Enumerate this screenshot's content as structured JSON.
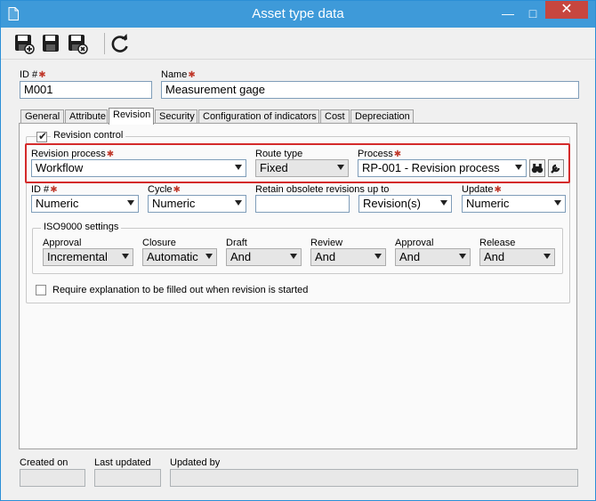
{
  "window": {
    "title": "Asset type data"
  },
  "toolbar": {
    "save_new": "save-new-icon",
    "save": "save-icon",
    "save_close": "save-close-icon",
    "refresh": "refresh-icon"
  },
  "header": {
    "id_label": "ID #",
    "id_value": "M001",
    "name_label": "Name",
    "name_value": "Measurement gage"
  },
  "tabs": [
    "General",
    "Attribute",
    "Revision",
    "Security",
    "Configuration of indicators",
    "Cost",
    "Depreciation"
  ],
  "revision": {
    "control_label": "Revision control",
    "control_checked": true,
    "process_label": "Revision process",
    "process_value": "Workflow",
    "route_label": "Route type",
    "route_value": "Fixed",
    "proc_label": "Process",
    "proc_value": "RP-001 - Revision process",
    "id_label": "ID #",
    "id_value": "Numeric",
    "cycle_label": "Cycle",
    "cycle_value": "Numeric",
    "retain_label": "Retain obsolete revisions up to",
    "retain_value": "",
    "retain_unit": "Revision(s)",
    "update_label": "Update",
    "update_value": "Numeric",
    "iso_label": "ISO9000 settings",
    "iso": [
      {
        "label": "Approval",
        "value": "Incremental"
      },
      {
        "label": "Closure",
        "value": "Automatic"
      },
      {
        "label": "Draft",
        "value": "And"
      },
      {
        "label": "Review",
        "value": "And"
      },
      {
        "label": "Approval",
        "value": "And"
      },
      {
        "label": "Release",
        "value": "And"
      }
    ],
    "explain_label": "Require explanation to be filled out when revision is started",
    "explain_checked": false
  },
  "footer": {
    "created_label": "Created on",
    "created_value": "",
    "updated_label": "Last updated",
    "updated_value": "",
    "updated_by_label": "Updated by",
    "updated_by_value": ""
  },
  "colors": {
    "title_bar": "#3e9ad9",
    "close": "#c7463f",
    "highlight": "#d42a2a",
    "required": "#c0392b"
  }
}
